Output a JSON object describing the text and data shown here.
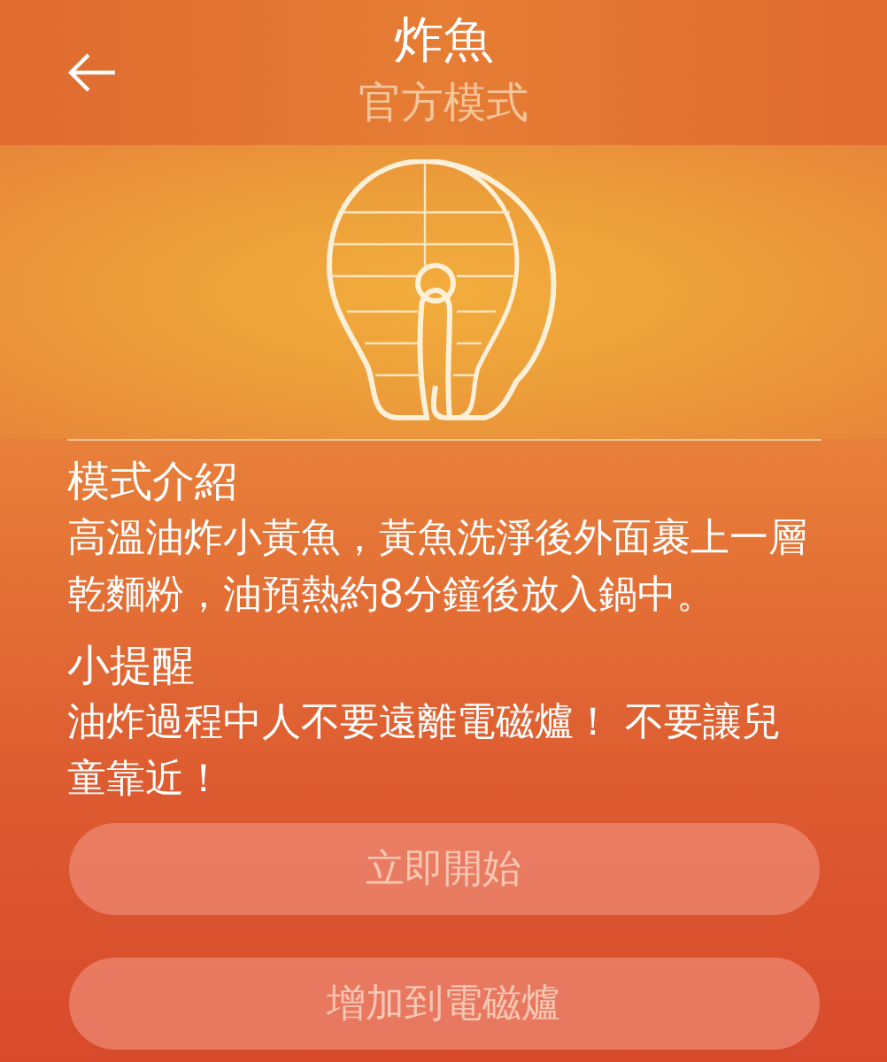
{
  "header": {
    "title": "炸魚",
    "subtitle": "官方模式"
  },
  "sections": [
    {
      "heading": "模式介紹",
      "body": "高溫油炸小黃魚，黃魚洗淨後外面裹上一層乾麵粉，油預熱約8分鐘後放入鍋中。"
    },
    {
      "heading": "小提醒",
      "body": "油炸過程中人不要遠離電磁爐！ 不要讓兒童靠近！"
    }
  ],
  "buttons": [
    "立即開始",
    "增加到電磁爐"
  ]
}
